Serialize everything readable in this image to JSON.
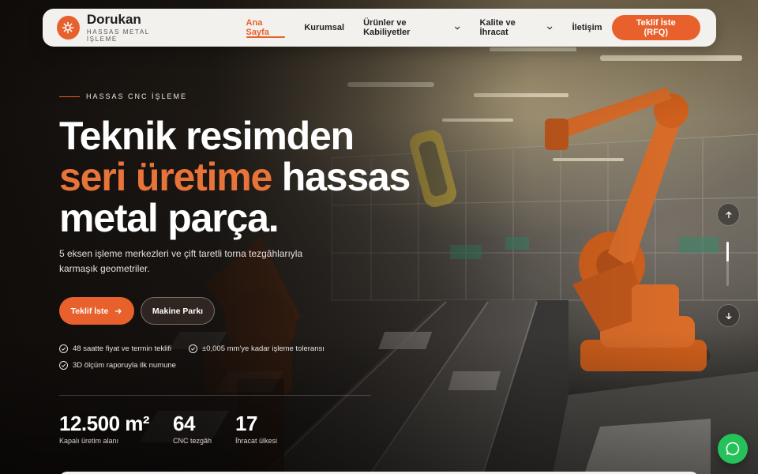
{
  "brand": {
    "name": "Dorukan",
    "tagline": "HASSAS METAL İŞLEME",
    "logo_icon": "gear-icon"
  },
  "nav": {
    "items": [
      {
        "label": "Ana Sayfa",
        "active": true,
        "dropdown": false
      },
      {
        "label": "Kurumsal",
        "active": false,
        "dropdown": false
      },
      {
        "label": "Ürünler ve Kabiliyetler",
        "active": false,
        "dropdown": true
      },
      {
        "label": "Kalite ve İhracat",
        "active": false,
        "dropdown": true
      },
      {
        "label": "İletişim",
        "active": false,
        "dropdown": false
      }
    ],
    "cta": "Teklif İste (RFQ)"
  },
  "hero": {
    "eyebrow": "HASSAS CNC İŞLEME",
    "headline": {
      "line1": "Teknik resimden",
      "accent": "seri üretime",
      "rest": " hassas",
      "line3": "metal parça."
    },
    "lead": "5 eksen işleme merkezleri ve çift taretli torna tezgâhlarıyla karmaşık geometriler.",
    "primary_cta": "Teklif İste",
    "secondary_cta": "Makine Parkı",
    "features": [
      "48 saatte fiyat ve termin teklifi",
      "±0,005 mm'ye kadar işleme toleransı",
      "3D ölçüm raporuyla ilk numune"
    ]
  },
  "stats": [
    {
      "value": "12.500 m²",
      "label": "Kapalı üretim alanı"
    },
    {
      "value": "64",
      "label": "CNC tezgâh"
    },
    {
      "value": "17",
      "label": "İhracat ülkesi"
    }
  ],
  "slider": {
    "progress": 0.45,
    "prev_icon": "arrow-up-icon",
    "next_icon": "arrow-down-icon"
  },
  "chat": {
    "icon": "whatsapp-chat-icon"
  },
  "colors": {
    "accent": "#e8602c",
    "header_bg": "#f3f1ee",
    "chat": "#25c25a"
  }
}
